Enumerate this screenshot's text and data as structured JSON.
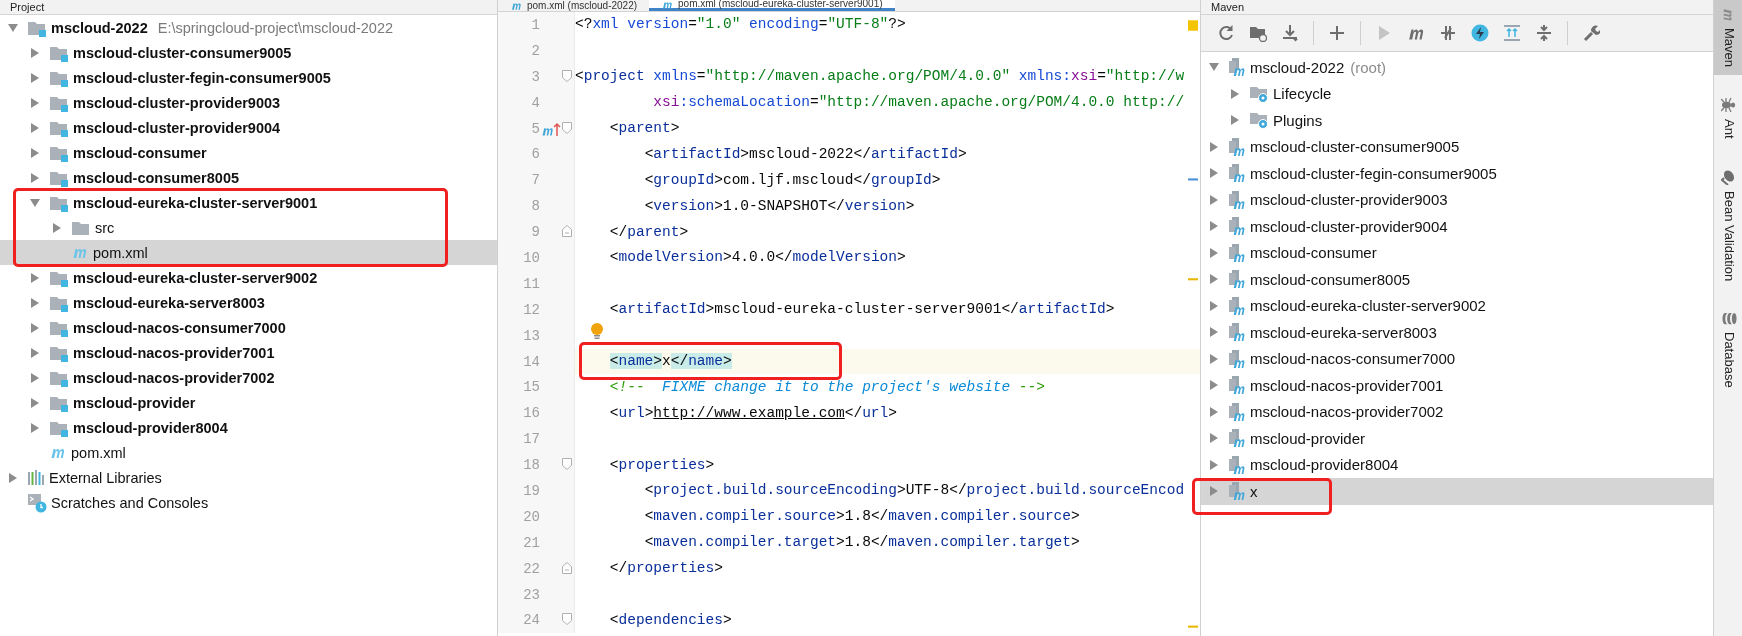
{
  "project_panel": {
    "title": "Project",
    "tree": [
      {
        "label": "mscloud-2022",
        "path": "E:\\springcloud-project\\mscloud-2022",
        "kind": "module",
        "expanded": true,
        "selected": false,
        "children": [
          {
            "label": "mscloud-cluster-consumer9005",
            "kind": "module",
            "expanded": false,
            "selected": false
          },
          {
            "label": "mscloud-cluster-fegin-consumer9005",
            "kind": "module",
            "expanded": false,
            "selected": false
          },
          {
            "label": "mscloud-cluster-provider9003",
            "kind": "module",
            "expanded": false,
            "selected": false
          },
          {
            "label": "mscloud-cluster-provider9004",
            "kind": "module",
            "expanded": false,
            "selected": false
          },
          {
            "label": "mscloud-consumer",
            "kind": "module",
            "expanded": false,
            "selected": false
          },
          {
            "label": "mscloud-consumer8005",
            "kind": "module",
            "expanded": false,
            "selected": false
          },
          {
            "label": "mscloud-eureka-cluster-server9001",
            "kind": "module",
            "expanded": true,
            "selected": false,
            "annotated": true,
            "children": [
              {
                "label": "src",
                "kind": "folder",
                "expanded": false,
                "selected": false
              },
              {
                "label": "pom.xml",
                "kind": "pom",
                "selected": true
              }
            ]
          },
          {
            "label": "mscloud-eureka-cluster-server9002",
            "kind": "module",
            "expanded": false,
            "selected": false
          },
          {
            "label": "mscloud-eureka-server8003",
            "kind": "module",
            "expanded": false,
            "selected": false
          },
          {
            "label": "mscloud-nacos-consumer7000",
            "kind": "module",
            "expanded": false,
            "selected": false
          },
          {
            "label": "mscloud-nacos-provider7001",
            "kind": "module",
            "expanded": false,
            "selected": false
          },
          {
            "label": "mscloud-nacos-provider7002",
            "kind": "module",
            "expanded": false,
            "selected": false
          },
          {
            "label": "mscloud-provider",
            "kind": "module",
            "expanded": false,
            "selected": false
          },
          {
            "label": "mscloud-provider8004",
            "kind": "module",
            "expanded": false,
            "selected": false
          },
          {
            "label": "pom.xml",
            "kind": "pom",
            "selected": false
          }
        ]
      },
      {
        "label": "External Libraries",
        "kind": "libraries",
        "expanded": false,
        "selected": false
      },
      {
        "label": "Scratches and Consoles",
        "kind": "scratches",
        "selected": false
      }
    ]
  },
  "editor": {
    "tabs": [
      {
        "label": "pom.xml (mscloud-2022)",
        "selected": false
      },
      {
        "label": "pom.xml (mscloud-eureka-cluster-server9001)",
        "selected": true
      }
    ],
    "lines": [
      {
        "number": "1",
        "tokens": [
          {
            "kind": "bracket",
            "text": "<?"
          },
          {
            "kind": "attr",
            "text": "xml"
          },
          {
            "kind": "attr",
            "text": " version"
          },
          {
            "kind": "bracket",
            "text": "="
          },
          {
            "kind": "value",
            "text": "\"1.0\""
          },
          {
            "kind": "attr",
            "text": " encoding"
          },
          {
            "kind": "bracket",
            "text": "="
          },
          {
            "kind": "value",
            "text": "\"UTF-8\""
          },
          {
            "kind": "bracket",
            "text": "?>"
          }
        ]
      },
      {
        "number": "2"
      },
      {
        "number": "3",
        "fold_start": true,
        "tokens": [
          {
            "kind": "bracket",
            "text": "<"
          },
          {
            "kind": "tag",
            "text": "project"
          },
          {
            "kind": "attr",
            "text": " xmlns"
          },
          {
            "kind": "bracket",
            "text": "="
          },
          {
            "kind": "value",
            "text": "\"http://maven.apache.org/POM/4.0.0\""
          },
          {
            "kind": "attr",
            "text": " xmlns:"
          },
          {
            "kind": "ns",
            "text": "xsi"
          },
          {
            "kind": "bracket",
            "text": "="
          },
          {
            "kind": "value",
            "text": "\"http://w"
          }
        ]
      },
      {
        "number": "4",
        "tokens": [
          {
            "kind": "ns",
            "text": "         xsi"
          },
          {
            "kind": "attr",
            "text": ":schemaLocation"
          },
          {
            "kind": "bracket",
            "text": "="
          },
          {
            "kind": "value",
            "text": "\"http://maven.apache.org/POM/4.0.0 http://"
          }
        ]
      },
      {
        "number": "5",
        "override_marker": true,
        "fold_start": true,
        "tokens": [
          {
            "kind": "bracket",
            "text": "    <"
          },
          {
            "kind": "tag",
            "text": "parent"
          },
          {
            "kind": "bracket",
            "text": ">"
          }
        ]
      },
      {
        "number": "6",
        "tokens": [
          {
            "kind": "bracket",
            "text": "        <"
          },
          {
            "kind": "tag",
            "text": "artifactId"
          },
          {
            "kind": "bracket",
            "text": ">"
          },
          {
            "kind": "text",
            "text": "mscloud-2022"
          },
          {
            "kind": "bracket",
            "text": "</"
          },
          {
            "kind": "tag",
            "text": "artifactId"
          },
          {
            "kind": "bracket",
            "text": ">"
          }
        ]
      },
      {
        "number": "7",
        "tokens": [
          {
            "kind": "bracket",
            "text": "        <"
          },
          {
            "kind": "tag",
            "text": "groupId"
          },
          {
            "kind": "bracket",
            "text": ">"
          },
          {
            "kind": "text",
            "text": "com.ljf.mscloud"
          },
          {
            "kind": "bracket",
            "text": "</"
          },
          {
            "kind": "tag",
            "text": "groupId"
          },
          {
            "kind": "bracket",
            "text": ">"
          }
        ]
      },
      {
        "number": "8",
        "tokens": [
          {
            "kind": "bracket",
            "text": "        <"
          },
          {
            "kind": "tag",
            "text": "version"
          },
          {
            "kind": "bracket",
            "text": ">"
          },
          {
            "kind": "text",
            "text": "1.0-SNAPSHOT"
          },
          {
            "kind": "bracket",
            "text": "</"
          },
          {
            "kind": "tag",
            "text": "version"
          },
          {
            "kind": "bracket",
            "text": ">"
          }
        ]
      },
      {
        "number": "9",
        "fold_end": true,
        "tokens": [
          {
            "kind": "bracket",
            "text": "    </"
          },
          {
            "kind": "tag",
            "text": "parent"
          },
          {
            "kind": "bracket",
            "text": ">"
          }
        ]
      },
      {
        "number": "10",
        "tokens": [
          {
            "kind": "bracket",
            "text": "    <"
          },
          {
            "kind": "tag",
            "text": "modelVersion"
          },
          {
            "kind": "bracket",
            "text": ">"
          },
          {
            "kind": "text",
            "text": "4.0.0"
          },
          {
            "kind": "bracket",
            "text": "</"
          },
          {
            "kind": "tag",
            "text": "modelVersion"
          },
          {
            "kind": "bracket",
            "text": ">"
          }
        ]
      },
      {
        "number": "11"
      },
      {
        "number": "12",
        "tokens": [
          {
            "kind": "bracket",
            "text": "    <"
          },
          {
            "kind": "tag",
            "text": "artifactId"
          },
          {
            "kind": "bracket",
            "text": ">"
          },
          {
            "kind": "text",
            "text": "mscloud-eureka-cluster-server9001"
          },
          {
            "kind": "bracket",
            "text": "</"
          },
          {
            "kind": "tag",
            "text": "artifactId"
          },
          {
            "kind": "bracket",
            "text": ">"
          }
        ]
      },
      {
        "number": "13",
        "bulb": true
      },
      {
        "number": "14",
        "current": true,
        "annotated": true,
        "tokens": [
          {
            "kind": "bracket",
            "text": "    <",
            "match": true
          },
          {
            "kind": "tag",
            "text": "name",
            "match": true
          },
          {
            "kind": "bracket",
            "text": ">",
            "match": true
          },
          {
            "kind": "text",
            "text": "x"
          },
          {
            "kind": "bracket",
            "text": "</",
            "match": true
          },
          {
            "kind": "tag",
            "text": "name",
            "match": true
          },
          {
            "kind": "bracket",
            "text": ">",
            "match": true
          }
        ]
      },
      {
        "number": "15",
        "tokens": [
          {
            "kind": "comment",
            "text": "    <!--  "
          },
          {
            "kind": "todo",
            "text": "FIXME change it to the project's website"
          },
          {
            "kind": "comment",
            "text": " -->"
          }
        ]
      },
      {
        "number": "16",
        "tokens": [
          {
            "kind": "bracket",
            "text": "    <"
          },
          {
            "kind": "tag",
            "text": "url"
          },
          {
            "kind": "bracket",
            "text": ">"
          },
          {
            "kind": "link",
            "text": "http://www.example.com"
          },
          {
            "kind": "bracket",
            "text": "</"
          },
          {
            "kind": "tag",
            "text": "url"
          },
          {
            "kind": "bracket",
            "text": ">"
          }
        ]
      },
      {
        "number": "17"
      },
      {
        "number": "18",
        "fold_start": true,
        "tokens": [
          {
            "kind": "bracket",
            "text": "    <"
          },
          {
            "kind": "tag",
            "text": "properties"
          },
          {
            "kind": "bracket",
            "text": ">"
          }
        ]
      },
      {
        "number": "19",
        "tokens": [
          {
            "kind": "bracket",
            "text": "        <"
          },
          {
            "kind": "tag",
            "text": "project.build.sourceEncoding"
          },
          {
            "kind": "bracket",
            "text": ">"
          },
          {
            "kind": "text",
            "text": "UTF-8"
          },
          {
            "kind": "bracket",
            "text": "</"
          },
          {
            "kind": "tag",
            "text": "project.build.sourceEncod"
          }
        ]
      },
      {
        "number": "20",
        "tokens": [
          {
            "kind": "bracket",
            "text": "        <"
          },
          {
            "kind": "tag",
            "text": "maven.compiler.source"
          },
          {
            "kind": "bracket",
            "text": ">"
          },
          {
            "kind": "text",
            "text": "1.8"
          },
          {
            "kind": "bracket",
            "text": "</"
          },
          {
            "kind": "tag",
            "text": "maven.compiler.source"
          },
          {
            "kind": "bracket",
            "text": ">"
          }
        ]
      },
      {
        "number": "21",
        "tokens": [
          {
            "kind": "bracket",
            "text": "        <"
          },
          {
            "kind": "tag",
            "text": "maven.compiler.target"
          },
          {
            "kind": "bracket",
            "text": ">"
          },
          {
            "kind": "text",
            "text": "1.8"
          },
          {
            "kind": "bracket",
            "text": "</"
          },
          {
            "kind": "tag",
            "text": "maven.compiler.target"
          },
          {
            "kind": "bracket",
            "text": ">"
          }
        ]
      },
      {
        "number": "22",
        "fold_end": true,
        "tokens": [
          {
            "kind": "bracket",
            "text": "    </"
          },
          {
            "kind": "tag",
            "text": "properties"
          },
          {
            "kind": "bracket",
            "text": ">"
          }
        ]
      },
      {
        "number": "23"
      },
      {
        "number": "24",
        "fold_start": true,
        "tokens": [
          {
            "kind": "bracket",
            "text": "    <"
          },
          {
            "kind": "tag",
            "text": "dependencies"
          },
          {
            "kind": "bracket",
            "text": ">"
          }
        ]
      }
    ]
  },
  "maven_panel": {
    "title": "Maven",
    "tree": [
      {
        "label": "mscloud-2022",
        "suffix": "(root)",
        "kind": "maven-module",
        "expanded": true,
        "selected": false,
        "children": [
          {
            "label": "Lifecycle",
            "kind": "config-folder",
            "expanded": false,
            "selected": false
          },
          {
            "label": "Plugins",
            "kind": "config-folder",
            "expanded": false,
            "selected": false
          }
        ]
      },
      {
        "label": "mscloud-cluster-consumer9005",
        "kind": "maven-module",
        "expanded": false,
        "selected": false
      },
      {
        "label": "mscloud-cluster-fegin-consumer9005",
        "kind": "maven-module",
        "expanded": false,
        "selected": false
      },
      {
        "label": "mscloud-cluster-provider9003",
        "kind": "maven-module",
        "expanded": false,
        "selected": false
      },
      {
        "label": "mscloud-cluster-provider9004",
        "kind": "maven-module",
        "expanded": false,
        "selected": false
      },
      {
        "label": "mscloud-consumer",
        "kind": "maven-module",
        "expanded": false,
        "selected": false
      },
      {
        "label": "mscloud-consumer8005",
        "kind": "maven-module",
        "expanded": false,
        "selected": false
      },
      {
        "label": "mscloud-eureka-cluster-server9002",
        "kind": "maven-module",
        "expanded": false,
        "selected": false
      },
      {
        "label": "mscloud-eureka-server8003",
        "kind": "maven-module",
        "expanded": false,
        "selected": false
      },
      {
        "label": "mscloud-nacos-consumer7000",
        "kind": "maven-module",
        "expanded": false,
        "selected": false
      },
      {
        "label": "mscloud-nacos-provider7001",
        "kind": "maven-module",
        "expanded": false,
        "selected": false
      },
      {
        "label": "mscloud-nacos-provider7002",
        "kind": "maven-module",
        "expanded": false,
        "selected": false
      },
      {
        "label": "mscloud-provider",
        "kind": "maven-module",
        "expanded": false,
        "selected": false
      },
      {
        "label": "mscloud-provider8004",
        "kind": "maven-module",
        "expanded": false,
        "selected": false
      },
      {
        "label": "x",
        "kind": "maven-module",
        "expanded": false,
        "selected": true,
        "annotated": true
      }
    ]
  },
  "side_tabs": [
    {
      "label": "Maven",
      "kind": "maven",
      "selected": true
    },
    {
      "label": "Ant",
      "kind": "ant",
      "selected": false
    },
    {
      "label": "Bean Validation",
      "kind": "bean",
      "selected": false
    },
    {
      "label": "Database",
      "kind": "database",
      "selected": false
    }
  ]
}
